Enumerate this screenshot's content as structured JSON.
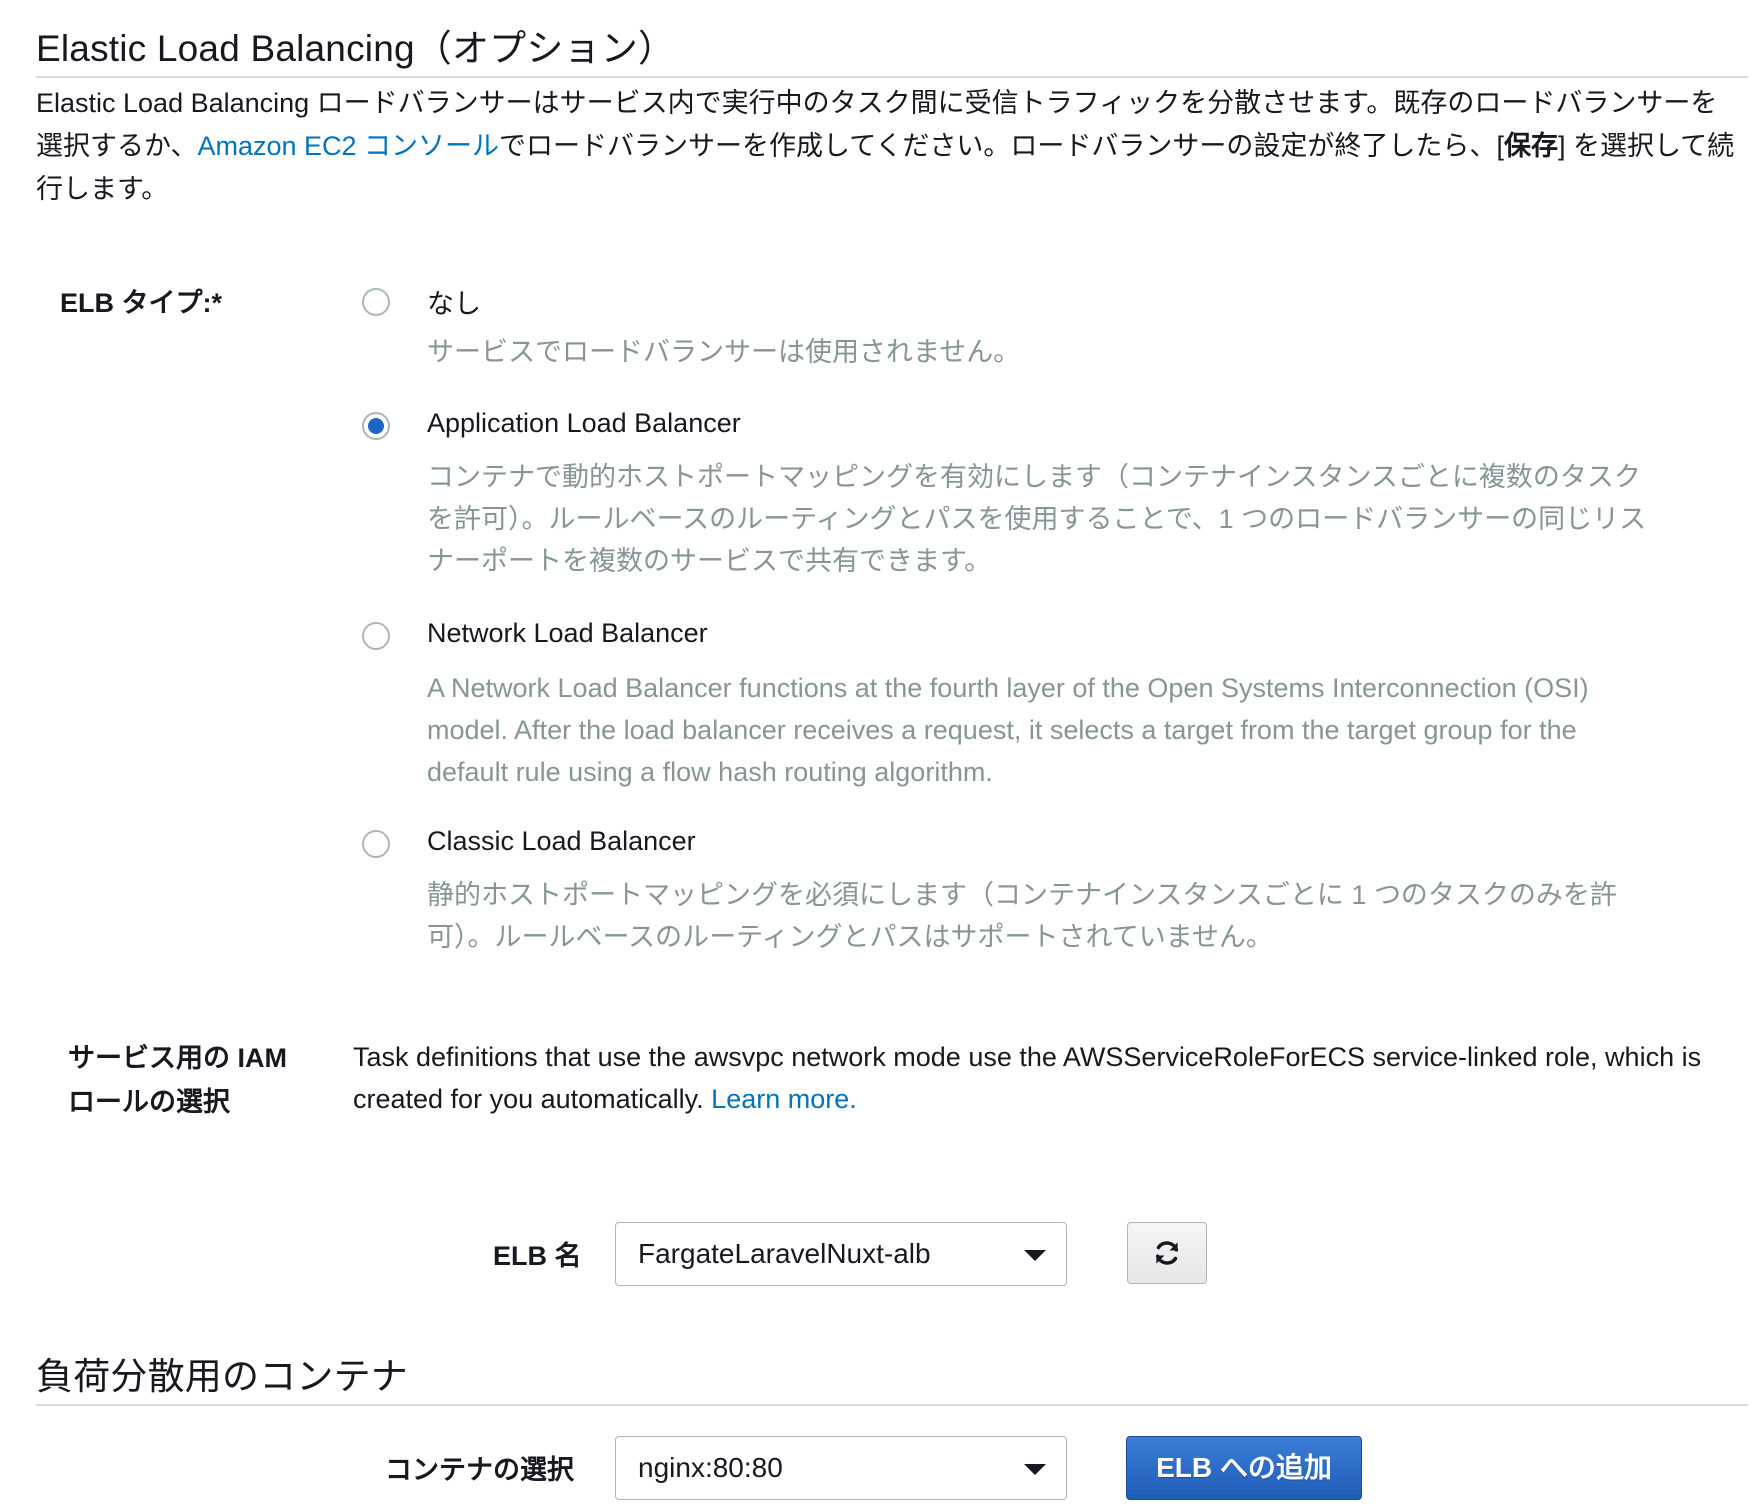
{
  "elb_section": {
    "title": "Elastic Load Balancing（オプション）",
    "intro_before_link": "Elastic Load Balancing ロードバランサーはサービス内で実行中のタスク間に受信トラフィックを分散させます。既存のロードバランサーを選択するか、",
    "intro_link": "Amazon EC2 コンソール",
    "intro_middle": "でロードバランサーを作成してください。ロードバランサーの設定が終了したら、",
    "intro_bracket_open": "[",
    "intro_bold": "保存",
    "intro_bracket_close": "]",
    "intro_after": " を選択して続行します。",
    "elb_type_label": "ELB タイプ:*",
    "options": [
      {
        "label": "なし",
        "description": "サービスでロードバランサーは使用されません。",
        "selected": false
      },
      {
        "label": "Application Load Balancer",
        "description": "コンテナで動的ホストポートマッピングを有効にします（コンテナインスタンスごとに複数のタスクを許可）。ルールベースのルーティングとパスを使用することで、1 つのロードバランサーの同じリスナーポートを複数のサービスで共有できます。",
        "selected": true
      },
      {
        "label": "Network Load Balancer",
        "description": "A Network Load Balancer functions at the fourth layer of the Open Systems Interconnection (OSI) model. After the load balancer receives a request, it selects a target from the target group for the default rule using a flow hash routing algorithm.",
        "selected": false
      },
      {
        "label": "Classic Load Balancer",
        "description": "静的ホストポートマッピングを必須にします（コンテナインスタンスごとに 1 つのタスクのみを許可）。ルールベースのルーティングとパスはサポートされていません。",
        "selected": false
      }
    ],
    "iam_label": "サービス用の IAM ロールの選択",
    "iam_text": "Task definitions that use the awsvpc network mode use the AWSServiceRoleForECS service-linked role, which is created for you automatically. ",
    "iam_link": "Learn more.",
    "elb_name_label": "ELB 名",
    "elb_name_value": "FargateLaravelNuxt-alb",
    "refresh_icon": "refresh-icon"
  },
  "container_section": {
    "title": "負荷分散用のコンテナ",
    "container_label": "コンテナの選択",
    "container_value": "nginx:80:80",
    "add_button": "ELB への追加"
  },
  "colors": {
    "link": "#0073bb",
    "radio_selected": "#1e66c6",
    "muted_text": "#879596",
    "primary_button": "#2a6cc7"
  }
}
